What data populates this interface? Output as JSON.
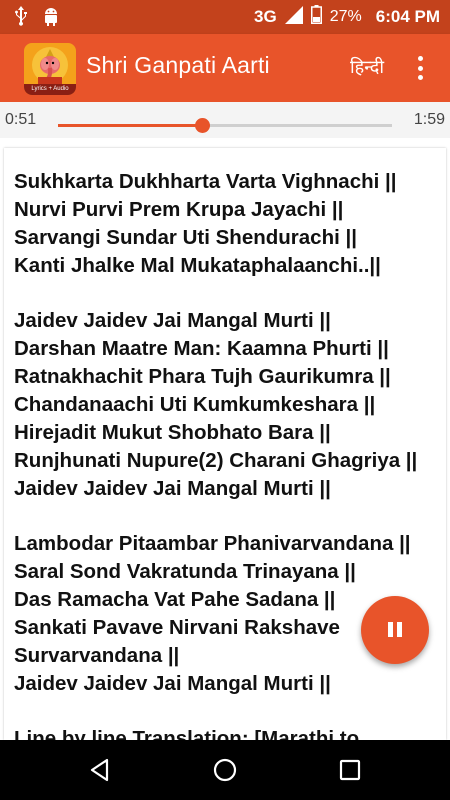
{
  "status_bar": {
    "network": "3G",
    "battery": "27%",
    "time": "6:04 PM"
  },
  "app_bar": {
    "title": "Shri Ganpati Aarti",
    "icon_caption": "Lyrics + Audio",
    "language_button": "हिन्दी"
  },
  "player": {
    "current_time": "0:51",
    "total_time": "1:59",
    "progress": 0.43
  },
  "lyrics": {
    "stanzas": [
      [
        "Sukhkarta Dukhharta Varta Vighnachi ||",
        "Nurvi Purvi Prem Krupa Jayachi ||",
        "Sarvangi Sundar Uti Shendurachi ||",
        "Kanti Jhalke Mal Mukataphalaanchi..||"
      ],
      [
        "Jaidev Jaidev Jai Mangal Murti ||",
        "Darshan Maatre Man: Kaamna Phurti ||",
        "Ratnakhachit Phara Tujh Gaurikumra ||",
        "Chandanaachi Uti Kumkumkeshara ||",
        "Hirejadit Mukut Shobhato Bara ||",
        "Runjhunati Nupure(2) Charani Ghagriya ||",
        "Jaidev Jaidev Jai Mangal Murti ||"
      ],
      [
        "Lambodar Pitaambar Phanivarvandana ||",
        "Saral Sond Vakratunda Trinayana ||",
        "Das Ramacha Vat Pahe Sadana ||",
        "Sankati Pavave Nirvani Rakshave",
        "Survarvandana ||",
        "Jaidev Jaidev Jai Mangal Murti ||"
      ]
    ],
    "translation_heading": "Line by line Translation: [Marathi to"
  },
  "icons": {
    "usb": "usb-icon",
    "android": "android-icon",
    "signal": "signal-icon",
    "battery": "battery-icon",
    "overflow": "more-vert-icon",
    "pause": "pause-icon",
    "back": "back-icon",
    "home": "home-icon",
    "recents": "recents-icon"
  },
  "colors": {
    "status_bar": "#c3421c",
    "accent": "#e8542a",
    "nav_bar": "#000000"
  }
}
